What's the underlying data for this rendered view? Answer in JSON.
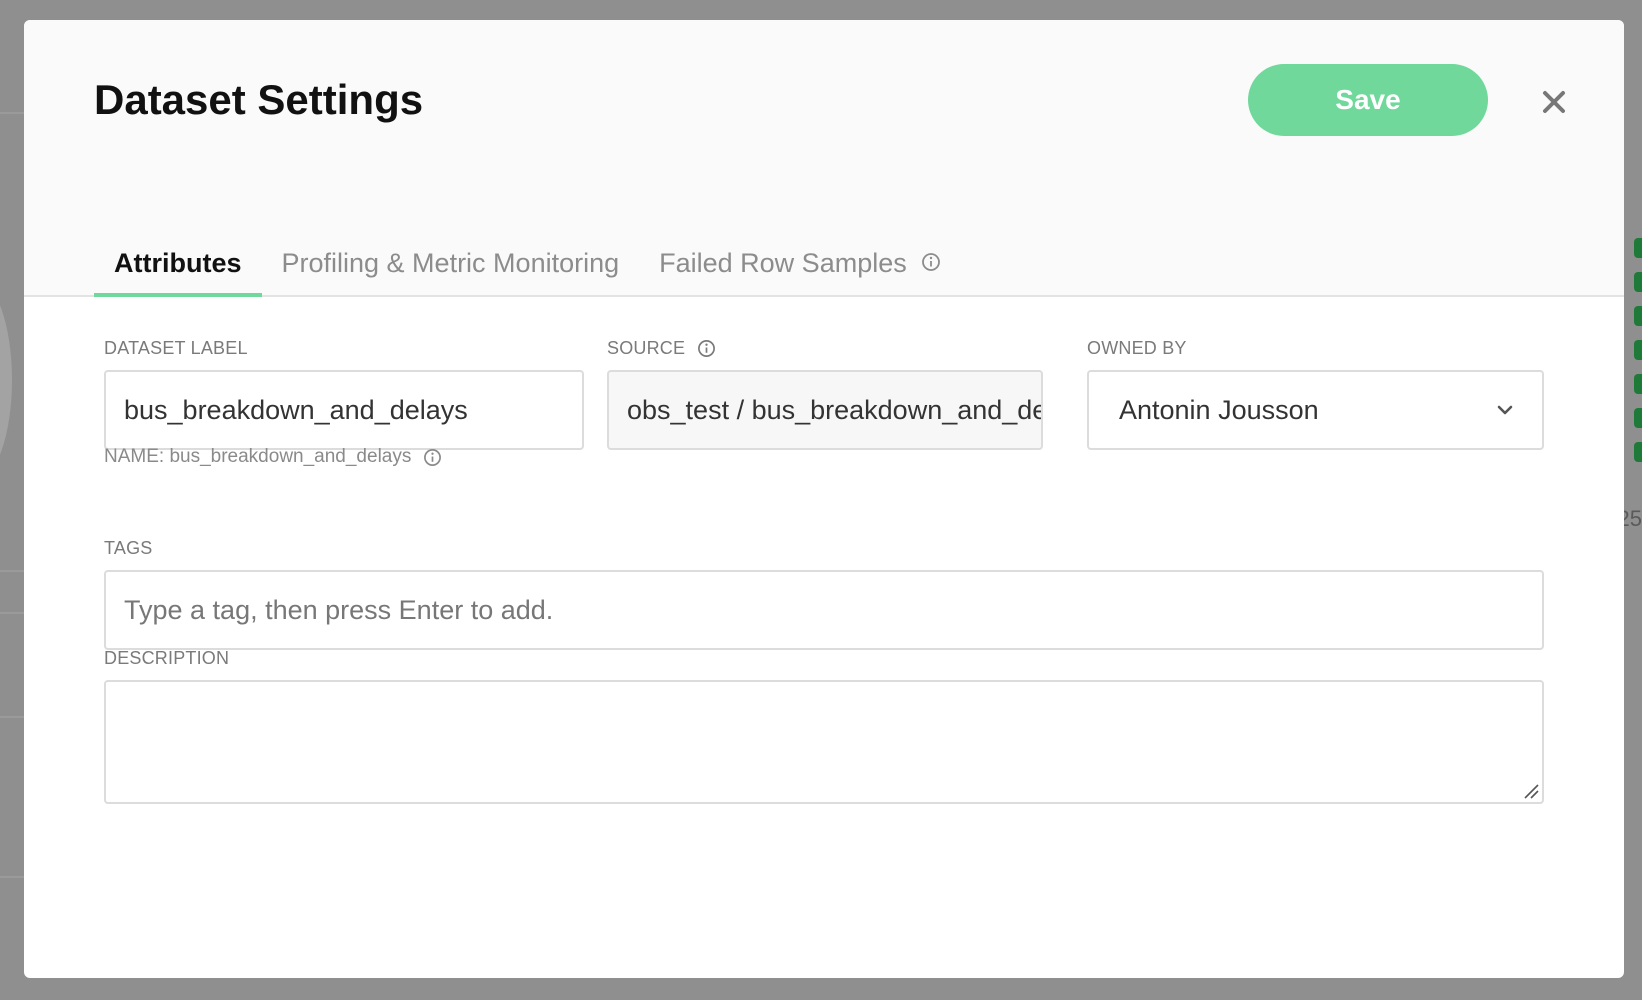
{
  "modal": {
    "title": "Dataset Settings",
    "save_label": "Save"
  },
  "tabs": [
    {
      "label": "Attributes",
      "active": true
    },
    {
      "label": "Profiling & Metric Monitoring",
      "active": false
    },
    {
      "label": "Failed Row Samples",
      "active": false
    }
  ],
  "fields": {
    "dataset_label": {
      "label": "DATASET LABEL",
      "value": "bus_breakdown_and_delays",
      "hint": "NAME: bus_breakdown_and_delays"
    },
    "source": {
      "label": "SOURCE",
      "value": "obs_test / bus_breakdown_and_delays"
    },
    "owned_by": {
      "label": "OWNED BY",
      "value": "Antonin Jousson"
    },
    "tags": {
      "label": "TAGS",
      "placeholder": "Type a tag, then press Enter to add."
    },
    "description": {
      "label": "DESCRIPTION",
      "value": ""
    }
  },
  "background": {
    "partial_number": "25"
  },
  "colors": {
    "accent": "#6fd89a",
    "overlay": "#8f8f8f"
  },
  "icons": {
    "close": "close-icon",
    "info": "info-icon",
    "chevron": "chevron-down-icon",
    "resize": "resize-handle-icon"
  }
}
